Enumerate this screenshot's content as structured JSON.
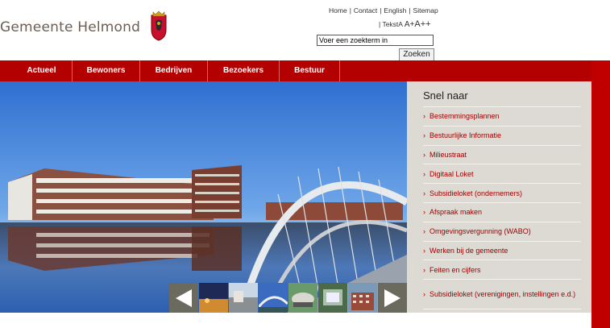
{
  "brand": {
    "name": "Gemeente Helmond"
  },
  "util_links": [
    "Home",
    "Contact",
    "English",
    "Sitemap"
  ],
  "text_size": {
    "label": "Tekst",
    "a": "A",
    "a_plus": "A+",
    "a_plus_plus": "A++"
  },
  "search": {
    "placeholder": "Voer een zoekterm in",
    "button": "Zoeken"
  },
  "nav": [
    "Actueel",
    "Bewoners",
    "Bedrijven",
    "Bezoekers",
    "Bestuur"
  ],
  "sidebar": {
    "title": "Snel naar",
    "items": [
      "Bestemmingsplannen",
      "Bestuurlijke Informatie",
      "Milieustraat",
      "Digitaal Loket",
      "Subsidieloket (ondernemers)",
      "Afspraak maken",
      "Omgevingsvergunning (WABO)",
      "Werken bij de gemeente",
      "Feiten en cijfers",
      "Subsidieloket (verenigingen, instellingen e.d.)"
    ]
  },
  "colors": {
    "brand_red": "#b30000",
    "sidebar_bg": "#dddad3",
    "link_red": "#a00000"
  }
}
